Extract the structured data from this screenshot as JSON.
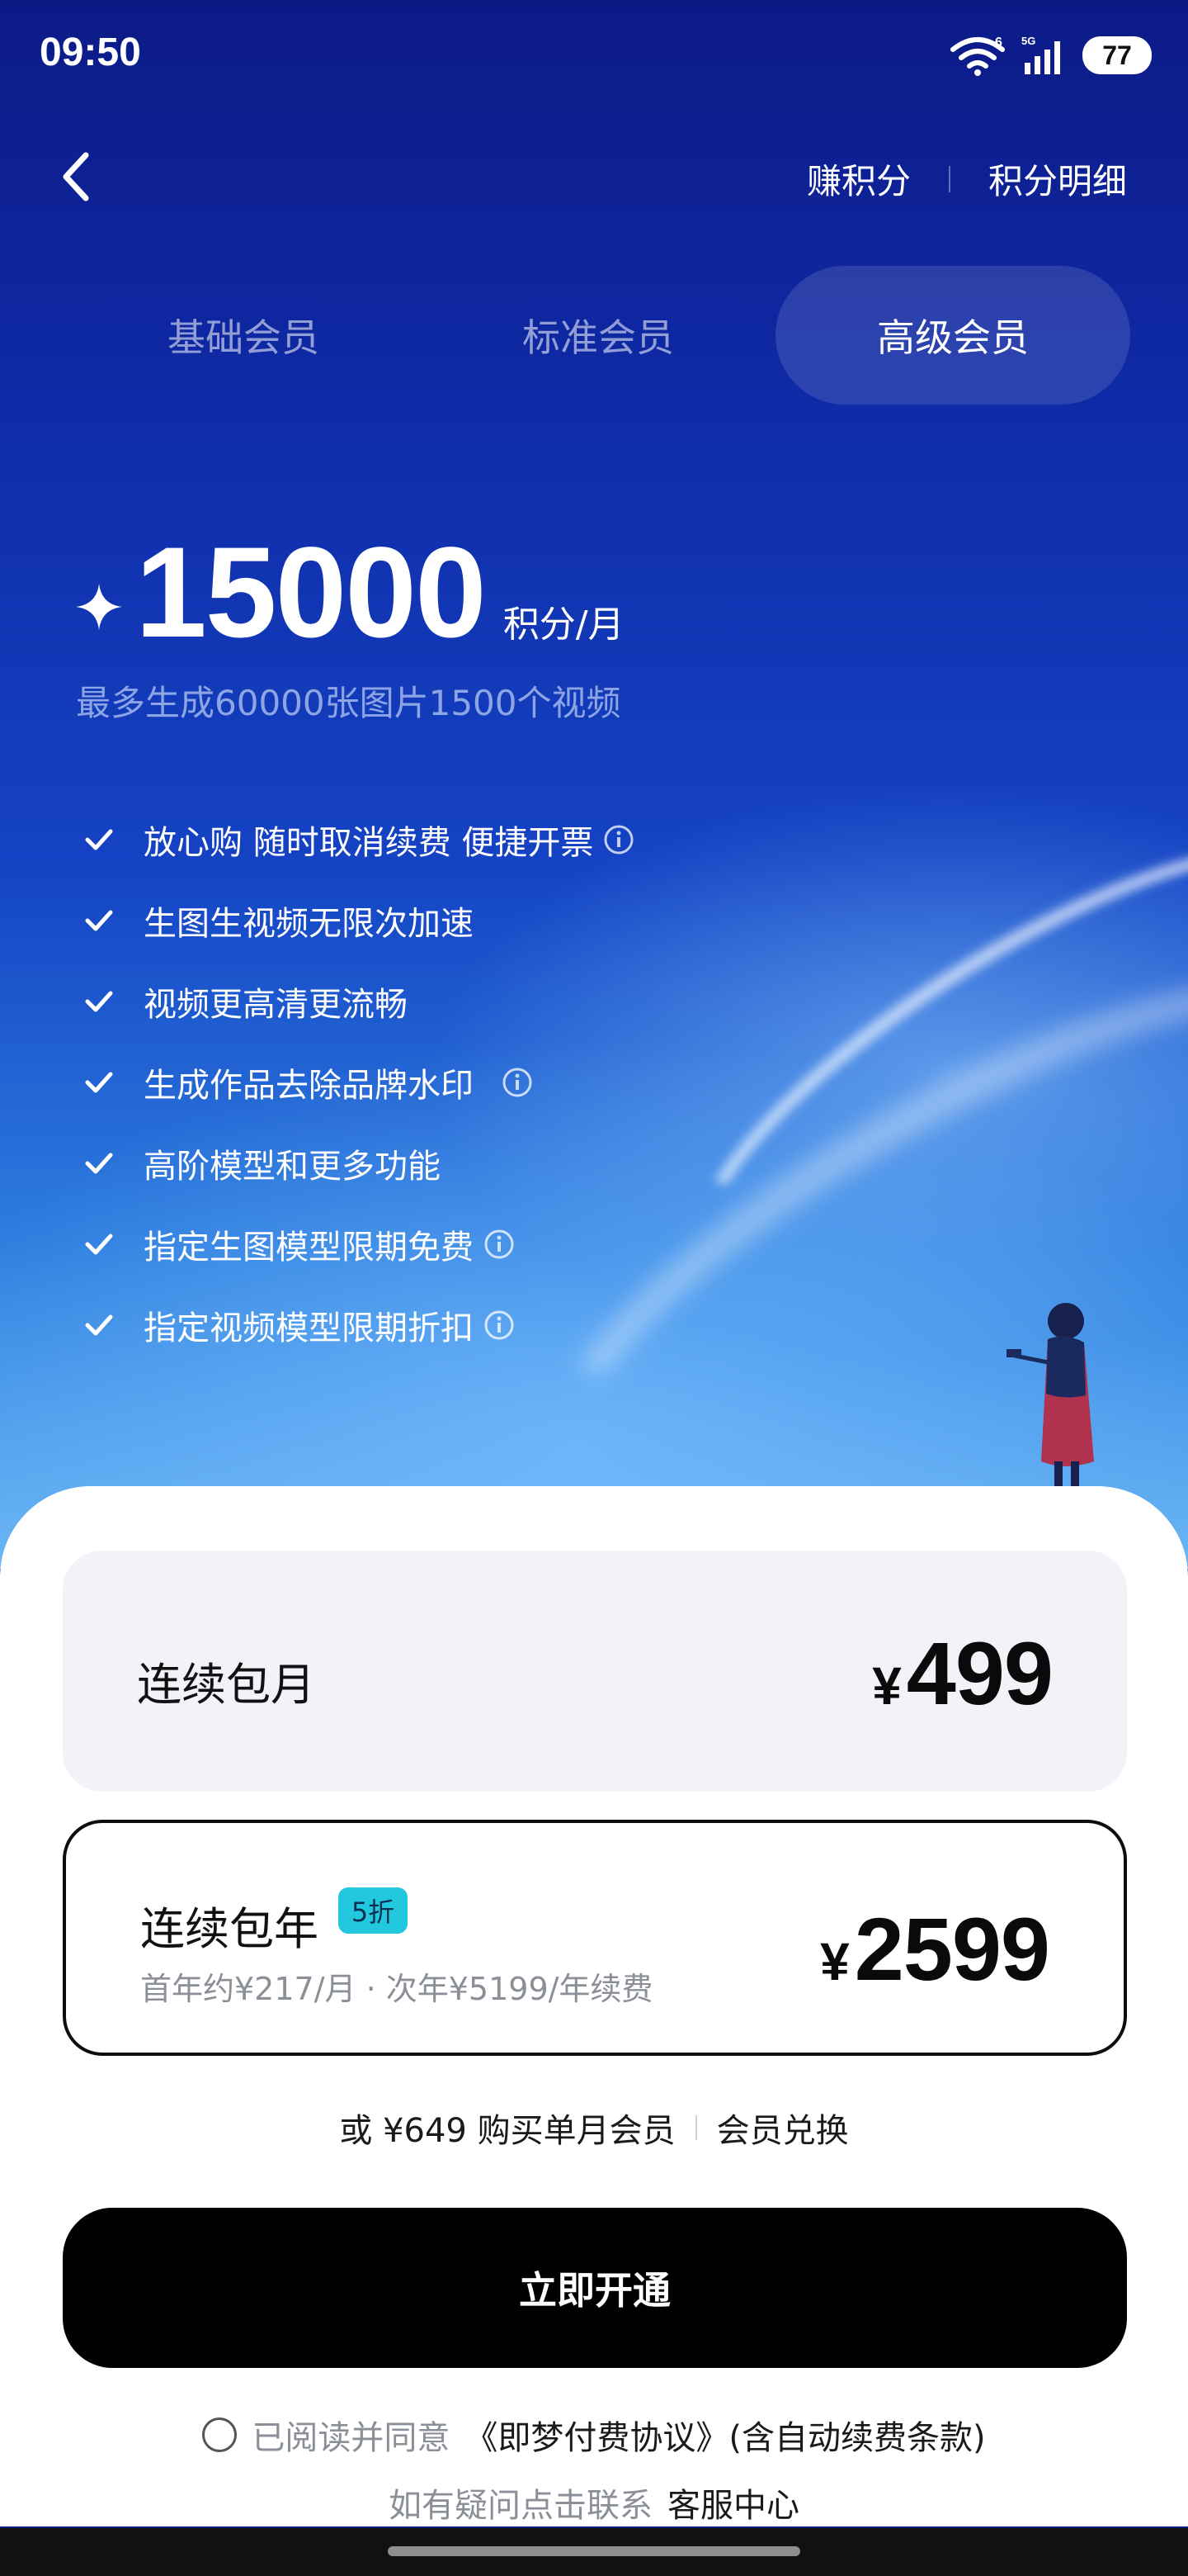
{
  "status_bar": {
    "time": "09:50",
    "battery": "77",
    "signal_labels": [
      "6",
      "5G"
    ]
  },
  "nav": {
    "earn_points": "赚积分",
    "points_detail": "积分明细"
  },
  "tabs": [
    {
      "label": "基础会员",
      "active": false
    },
    {
      "label": "标准会员",
      "active": false
    },
    {
      "label": "高级会员",
      "active": true
    }
  ],
  "credits": {
    "amount": "15000",
    "unit": "积分/月",
    "subtitle": "最多生成60000张图片1500个视频"
  },
  "features": [
    {
      "text": "放心购 随时取消续费 便捷开票",
      "info": true
    },
    {
      "text": "生图生视频无限次加速",
      "info": false
    },
    {
      "text": "视频更高清更流畅",
      "info": false
    },
    {
      "text": "生成作品去除品牌水印",
      "info": true
    },
    {
      "text": "高阶模型和更多功能",
      "info": false
    },
    {
      "text": "指定生图模型限期免费",
      "info": true
    },
    {
      "text": "指定视频模型限期折扣",
      "info": true
    }
  ],
  "plans": {
    "monthly": {
      "label": "连续包月",
      "currency": "¥",
      "price": "499"
    },
    "yearly": {
      "label": "连续包年",
      "badge": "5折",
      "sub": "首年约¥217/月 · 次年¥5199/年续费",
      "currency": "¥",
      "price": "2599",
      "selected": true
    }
  },
  "alt": {
    "single_month": "或 ¥649 购买单月会员",
    "redeem": "会员兑换"
  },
  "cta": "立即开通",
  "agreement": {
    "prefix": "已阅读并同意",
    "link": "《即梦付费协议》(含自动续费条款)"
  },
  "help": {
    "prefix": "如有疑问点击联系",
    "link": "客服中心"
  },
  "colors": {
    "hero_top": "#0c1a86",
    "hero_bottom": "#6ab6f5",
    "badge": "#22c9de",
    "cta": "#000000",
    "plan_bg": "#f1f3f8"
  }
}
